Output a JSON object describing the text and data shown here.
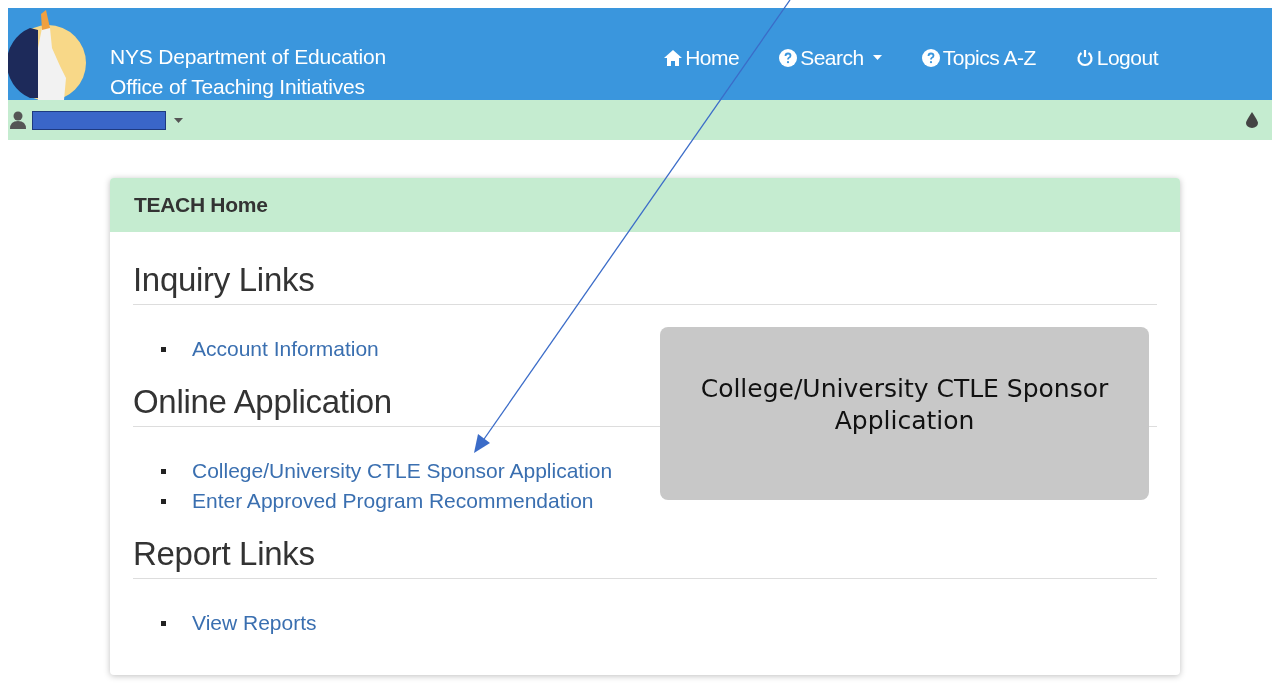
{
  "header": {
    "title_lines": [
      "NYS Department of Education",
      "Office of Teaching Initiatives"
    ],
    "nav": [
      {
        "label": "Home",
        "kind": "home",
        "dropdown": false
      },
      {
        "label": "Search",
        "kind": "question",
        "dropdown": true
      },
      {
        "label": "Topics A-Z",
        "kind": "question",
        "dropdown": false
      },
      {
        "label": "Logout",
        "kind": "power",
        "dropdown": false
      }
    ]
  },
  "user_bar": {
    "name_redacted": true,
    "dropdown": true
  },
  "card": {
    "title": "TEACH Home",
    "sections": [
      {
        "heading": "Inquiry Links",
        "links": [
          "Account Information"
        ]
      },
      {
        "heading": "Online Application",
        "links": [
          "College/University CTLE Sponsor Application",
          "Enter Approved Program Recommendation"
        ]
      },
      {
        "heading": "Report Links",
        "links": [
          "View Reports"
        ]
      }
    ]
  },
  "callout": {
    "text": "College/University CTLE Sponsor Application"
  }
}
